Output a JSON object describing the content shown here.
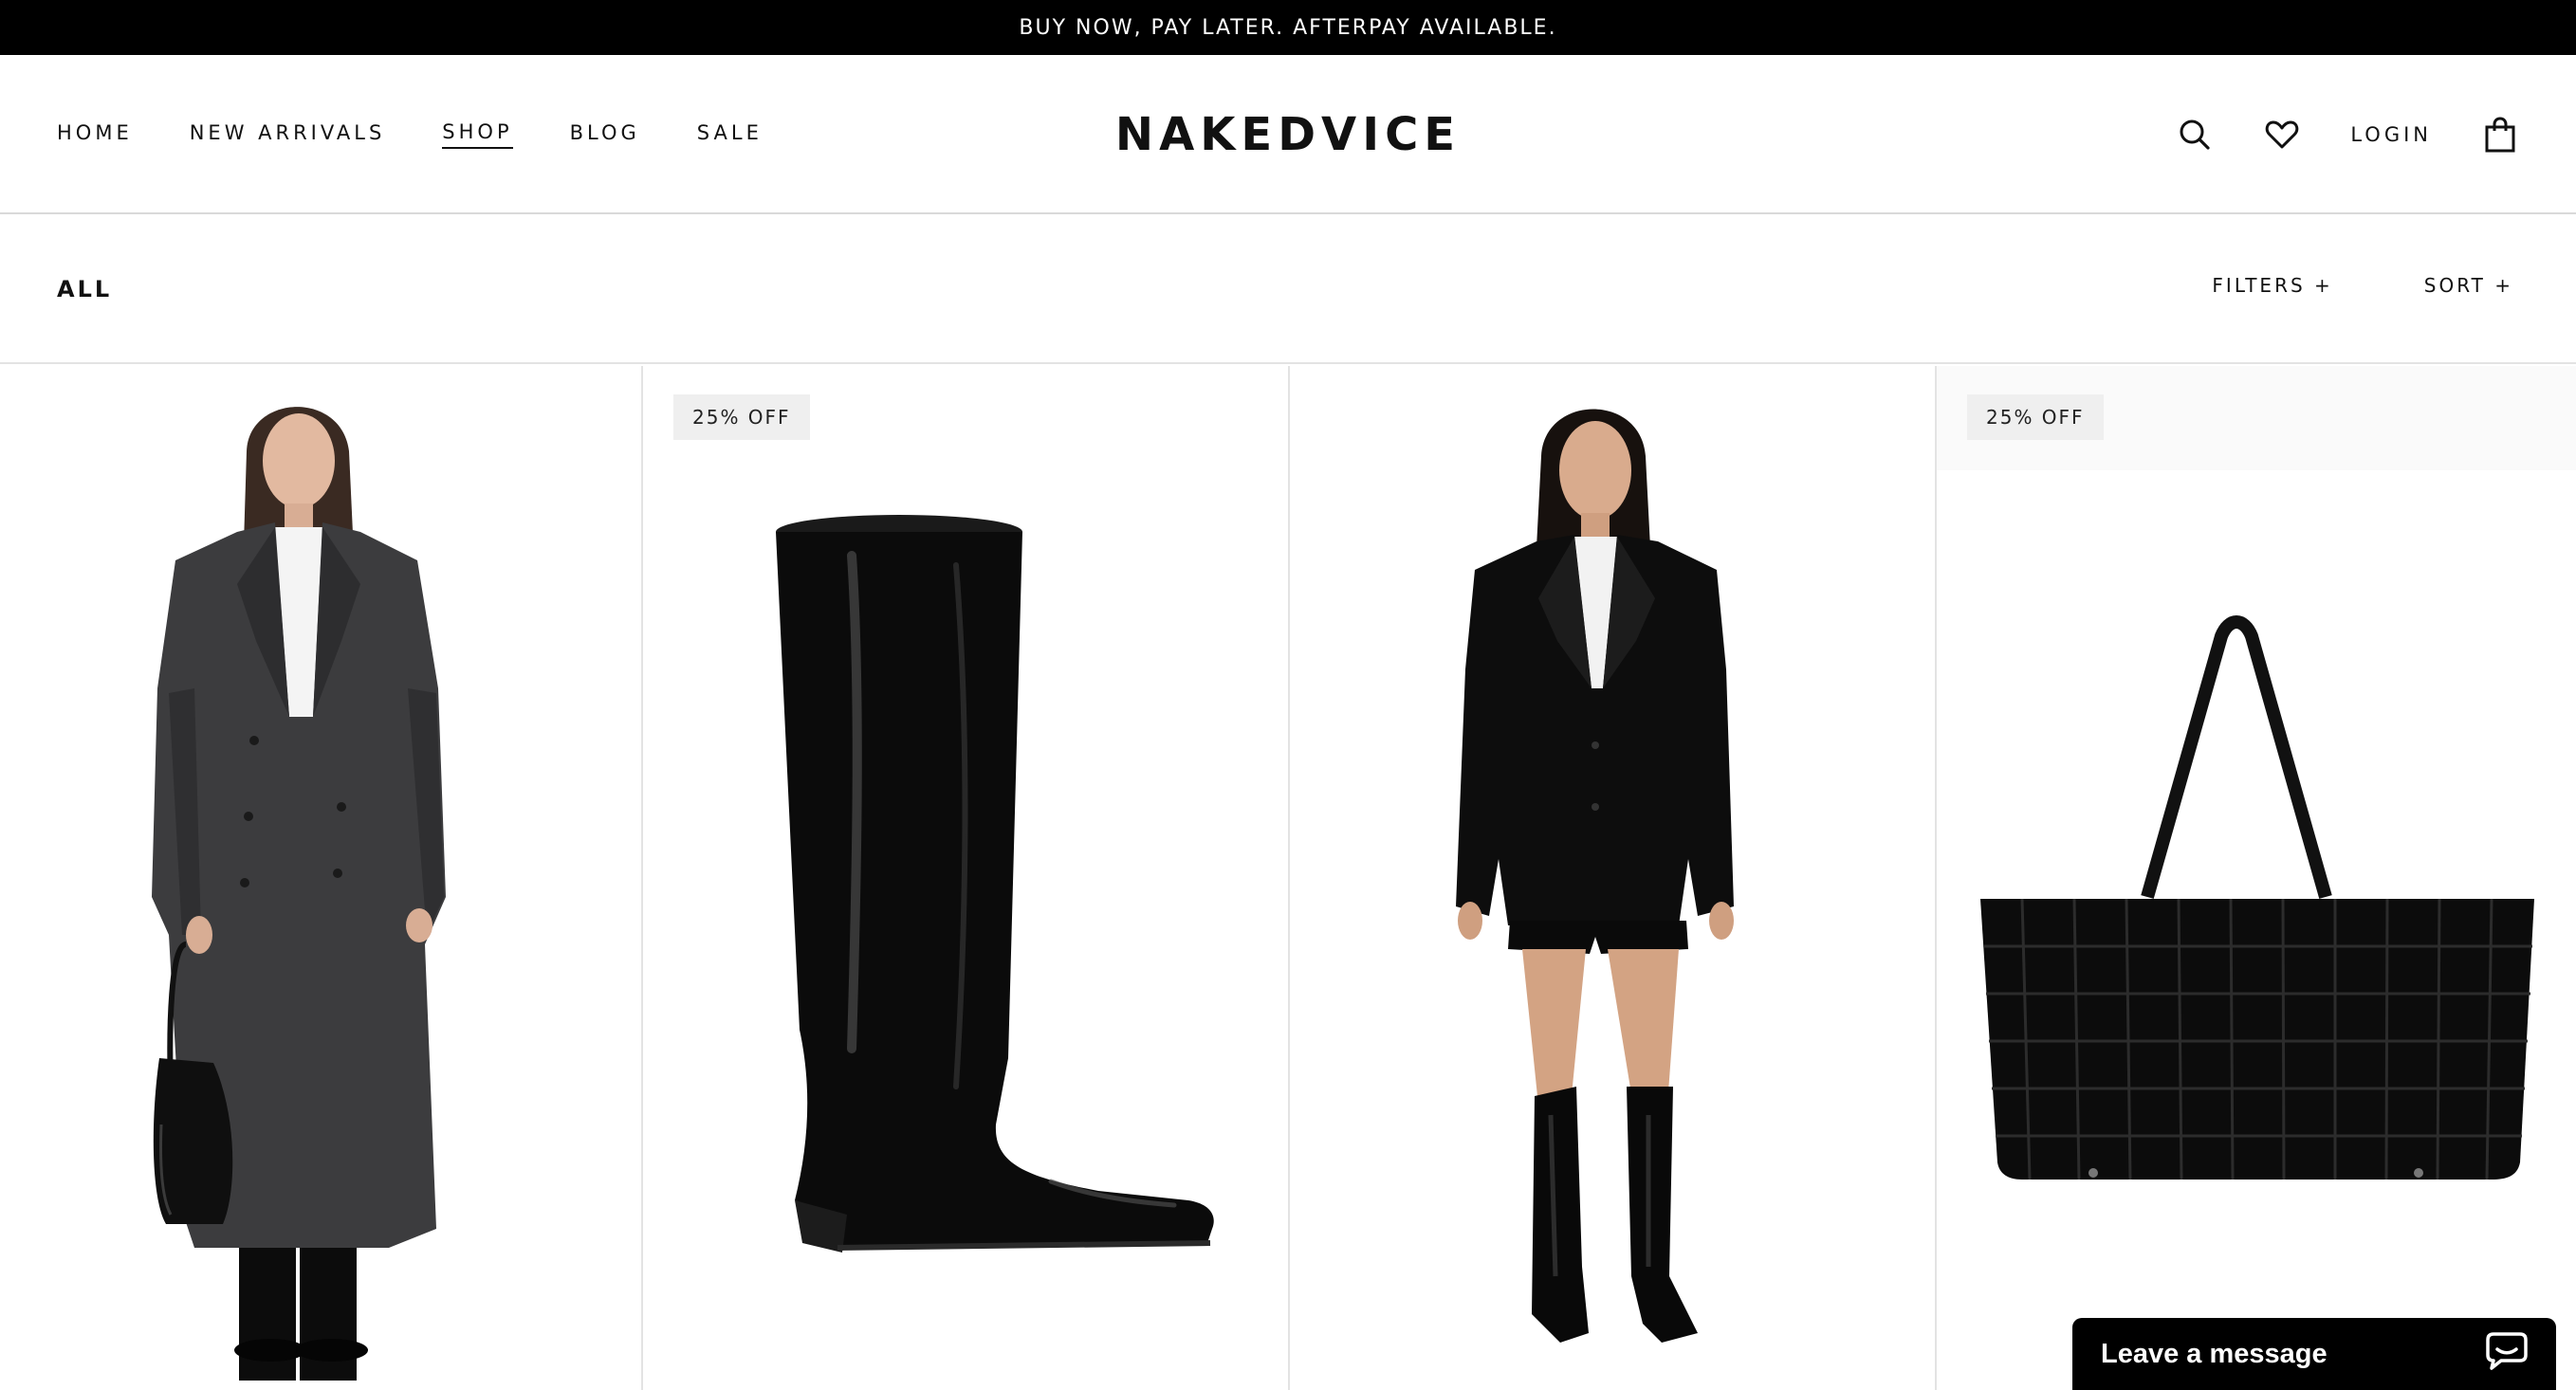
{
  "announcement": "BUY NOW, PAY LATER. AFTERPAY AVAILABLE.",
  "nav": {
    "items": [
      {
        "label": "HOME",
        "active": false
      },
      {
        "label": "NEW ARRIVALS",
        "active": false
      },
      {
        "label": "SHOP",
        "active": true
      },
      {
        "label": "BLOG",
        "active": false
      },
      {
        "label": "SALE",
        "active": false
      }
    ]
  },
  "logo": "NAKEDVICE",
  "header": {
    "login_label": "LOGIN",
    "icons": [
      "search-icon",
      "heart-icon",
      "shopping-bag-icon"
    ]
  },
  "collection": {
    "title": "ALL",
    "filters_label": "FILTERS +",
    "sort_label": "SORT +"
  },
  "products": [
    {
      "image": "model-long-charcoal-coat-image",
      "badge": ""
    },
    {
      "image": "black-knee-high-boot-image",
      "badge": "25% OFF"
    },
    {
      "image": "model-black-blazer-boots-image",
      "badge": ""
    },
    {
      "image": "black-woven-tote-bag-image",
      "badge": "25% OFF"
    }
  ],
  "chat": {
    "label": "Leave a message",
    "icon": "chat-bubble-icon"
  },
  "colors": {
    "announcement_bg": "#000000",
    "text": "#111111",
    "badge_bg": "#efefef",
    "divider": "#e3e3e3"
  }
}
